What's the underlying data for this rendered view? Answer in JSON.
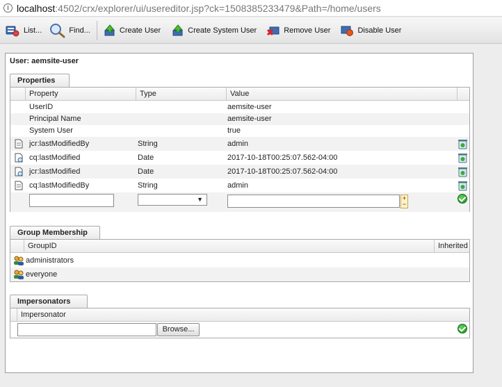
{
  "browser": {
    "url_host": "localhost",
    "url_rest": ":4502/crx/explorer/ui/usereditor.jsp?ck=1508385233479&Path=/home/users"
  },
  "toolbar": {
    "list_label": "List...",
    "find_label": "Find...",
    "create_user_label": "Create User",
    "create_system_user_label": "Create System User",
    "remove_user_label": "Remove User",
    "disable_user_label": "Disable User"
  },
  "panel": {
    "title": "User: aemsite-user"
  },
  "properties": {
    "tab_label": "Properties",
    "columns": [
      "Property",
      "Type",
      "Value"
    ],
    "rows": [
      {
        "property": "UserID",
        "type": "",
        "value": "aemsite-user"
      },
      {
        "property": "Principal Name",
        "type": "",
        "value": "aemsite-user"
      },
      {
        "property": "System User",
        "type": "",
        "value": "true"
      },
      {
        "property": "jcr:lastModifiedBy",
        "type": "String",
        "value": "admin"
      },
      {
        "property": "cq:lastModified",
        "type": "Date",
        "value": "2017-10-18T00:25:07.562-04:00"
      },
      {
        "property": "jcr:lastModified",
        "type": "Date",
        "value": "2017-10-18T00:25:07.562-04:00"
      },
      {
        "property": "cq:lastModifiedBy",
        "type": "String",
        "value": "admin"
      }
    ],
    "new_property_value": "",
    "new_value_value": ""
  },
  "groups": {
    "tab_label": "Group Membership",
    "columns": [
      "GroupID",
      "Inherited"
    ],
    "rows": [
      {
        "group": "administrators"
      },
      {
        "group": "everyone"
      }
    ]
  },
  "impersonators": {
    "tab_label": "Impersonators",
    "column": "Impersonator",
    "input_value": "",
    "browse_label": "Browse..."
  }
}
